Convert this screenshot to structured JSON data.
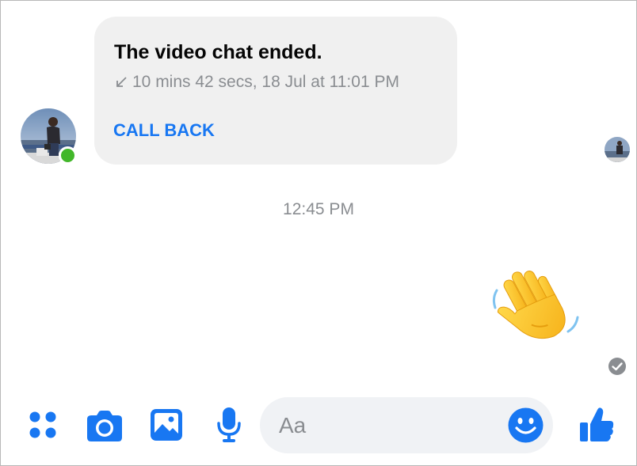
{
  "call": {
    "title": "The video chat ended.",
    "details": "10 mins 42 secs, 18 Jul at 11:01 PM",
    "action_label": "CALL BACK",
    "direction_icon": "incoming-arrow-icon"
  },
  "contact": {
    "online": true,
    "presence_color": "#42b72a"
  },
  "timestamp": "12:45 PM",
  "sent_message": {
    "emoji": "waving-hand"
  },
  "composer": {
    "placeholder": "Aa",
    "value": "",
    "icons": [
      "apps-menu-icon",
      "camera-icon",
      "gallery-icon",
      "microphone-icon",
      "emoji-icon",
      "thumbs-up-icon"
    ]
  },
  "colors": {
    "accent": "#1877f2",
    "bubble_bg": "#f0f0f0",
    "meta_text": "#8a8d91"
  }
}
